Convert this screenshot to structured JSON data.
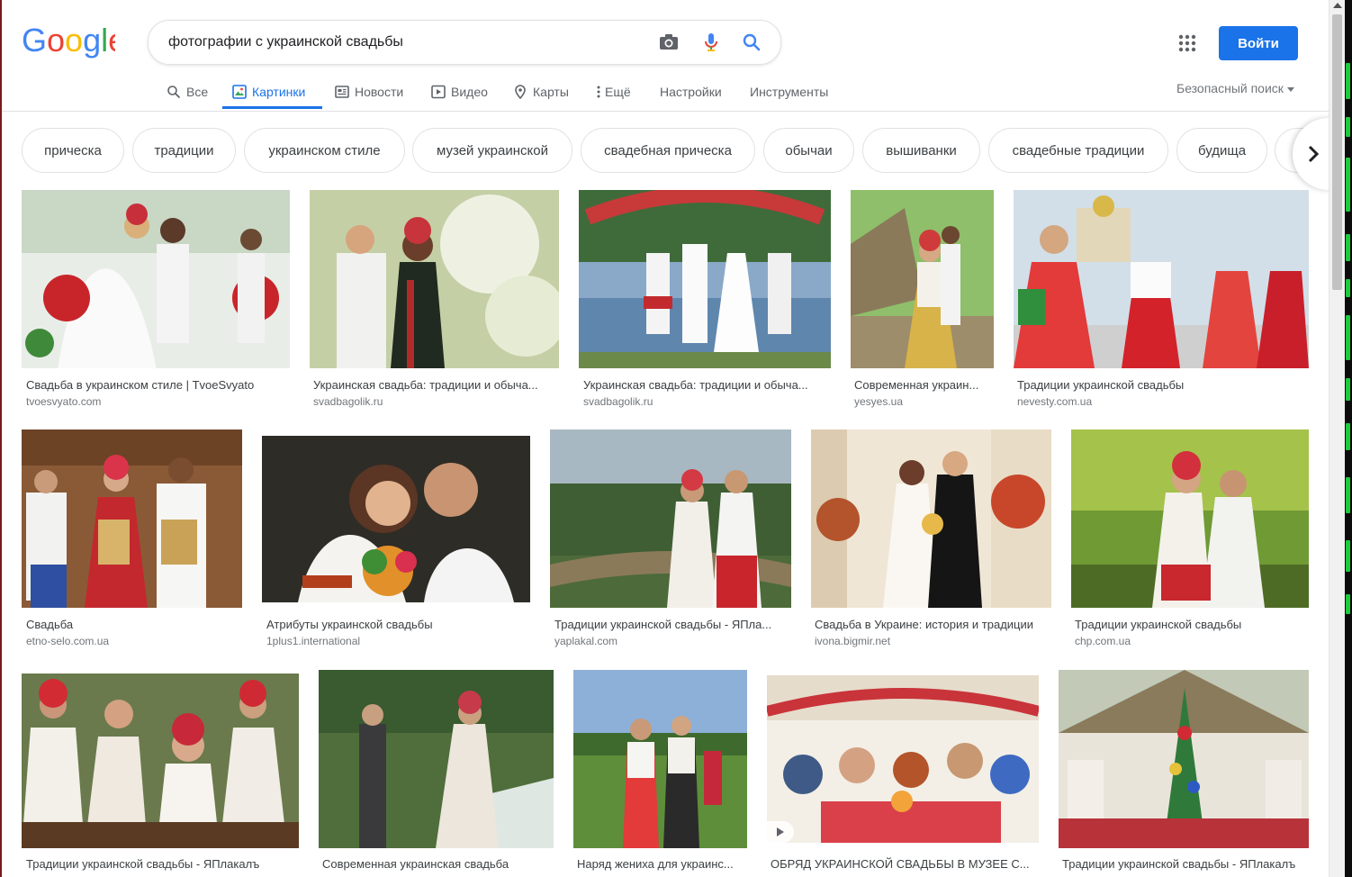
{
  "search": {
    "query": "фотографии с украинской свадьбы"
  },
  "header": {
    "signin_label": "Войти",
    "safe_search_label": "Безопасный поиск"
  },
  "nav": [
    {
      "label": "Все",
      "icon": "search-icon",
      "active": false
    },
    {
      "label": "Картинки",
      "icon": "image-icon",
      "active": true
    },
    {
      "label": "Новости",
      "icon": "news-icon",
      "active": false
    },
    {
      "label": "Видео",
      "icon": "video-icon",
      "active": false
    },
    {
      "label": "Карты",
      "icon": "map-pin-icon",
      "active": false
    },
    {
      "label": "Ещё",
      "icon": "more-vert-icon",
      "active": false
    },
    {
      "label": "Настройки",
      "icon": "",
      "active": false
    },
    {
      "label": "Инструменты",
      "icon": "",
      "active": false
    }
  ],
  "chips": [
    "прическа",
    "традиции",
    "украинском стиле",
    "музей украинской",
    "свадебная прическа",
    "обычаи",
    "вышиванки",
    "свадебные традиции",
    "будища"
  ],
  "colors": {
    "accent": "#1a73e8",
    "chip_border": "#dfe1e5",
    "site_text": "#70757a"
  },
  "results": [
    {
      "title": "Свадьба в украинском стиле | TvoeSvyato",
      "site": "tvoesvyato.com"
    },
    {
      "title": "Украинская свадьба: традиции и обыча...",
      "site": "svadbagolik.ru"
    },
    {
      "title": "Украинская свадьба: традиции и обыча...",
      "site": "svadbagolik.ru"
    },
    {
      "title": "Современная украин...",
      "site": "yesyes.ua"
    },
    {
      "title": "Традиции украинской свадьбы",
      "site": "nevesty.com.ua"
    },
    {
      "title": "Свадьба",
      "site": "etno-selo.com.ua"
    },
    {
      "title": "Атрибуты украинской свадьбы",
      "site": "1plus1.international"
    },
    {
      "title": "Традиции украинской свадьбы - ЯПла...",
      "site": "yaplakal.com"
    },
    {
      "title": "Свадьба в Украине: история и традиции",
      "site": "ivona.bigmir.net"
    },
    {
      "title": "Традиции украинской свадьбы",
      "site": "chp.com.ua"
    },
    {
      "title": "Традиции украинской свадьбы - ЯПлакалъ",
      "site": ""
    },
    {
      "title": "Современная украинская свадьба",
      "site": ""
    },
    {
      "title": "Наряд жениха для украинс...",
      "site": ""
    },
    {
      "title": "ОБРЯД УКРАИНСКОЙ СВАДЬБЫ В МУЗЕЕ С...",
      "site": ""
    },
    {
      "title": "Традиции украинской свадьбы - ЯПлакалъ",
      "site": ""
    }
  ]
}
